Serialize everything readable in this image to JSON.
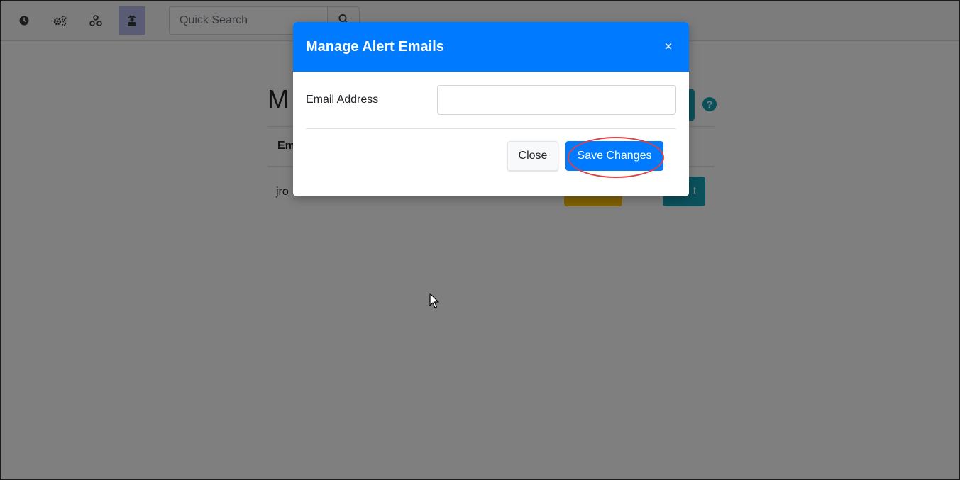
{
  "navbar": {
    "icons": [
      "clock-icon",
      "gears-icon",
      "network-icon",
      "user-secret-icon"
    ],
    "search": {
      "placeholder": "Quick Search",
      "value": ""
    }
  },
  "page": {
    "title": "M",
    "column_header": "Em",
    "row_email": "jro",
    "delete_label_fragment": "t",
    "help_label": "?"
  },
  "modal": {
    "title": "Manage Alert Emails",
    "close_x": "×",
    "field_label": "Email Address",
    "field_value": "",
    "close_button": "Close",
    "save_button": "Save Changes"
  },
  "colors": {
    "primary": "#007bff",
    "info": "#17a2b8",
    "warning": "#ffc107",
    "active_nav": "#b5b8ec",
    "highlight": "#e04040"
  }
}
